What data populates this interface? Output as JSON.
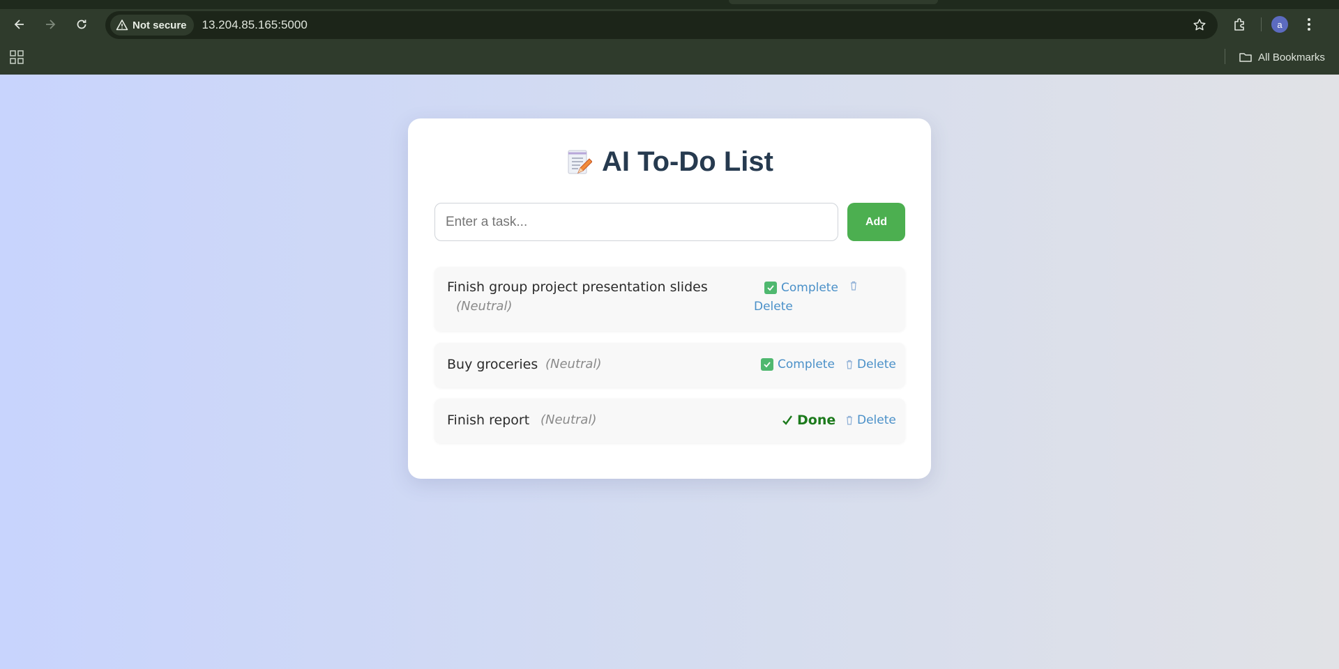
{
  "browser": {
    "security_label": "Not secure",
    "url": "13.204.85.165:5000",
    "avatar_letter": "a",
    "all_bookmarks_label": "All Bookmarks"
  },
  "app": {
    "title": "AI To-Do List",
    "title_icon": "memo-emoji",
    "input_placeholder": "Enter a task...",
    "add_label": "Add",
    "tasks": [
      {
        "name": "Finish group project presentation slides",
        "sentiment": "(Neutral)",
        "complete_label": "Complete",
        "delete_label": "Delete",
        "status": "pending"
      },
      {
        "name": "Buy groceries",
        "sentiment": "(Neutral)",
        "complete_label": "Complete",
        "delete_label": "Delete",
        "status": "pending"
      },
      {
        "name": "Finish report",
        "sentiment": "(Neutral)",
        "done_label": "Done",
        "delete_label": "Delete",
        "status": "done"
      }
    ]
  },
  "colors": {
    "accent_green": "#4caf50",
    "link_blue": "#4a90c8",
    "done_green": "#1c7a1c",
    "title_color": "#263a4f"
  }
}
